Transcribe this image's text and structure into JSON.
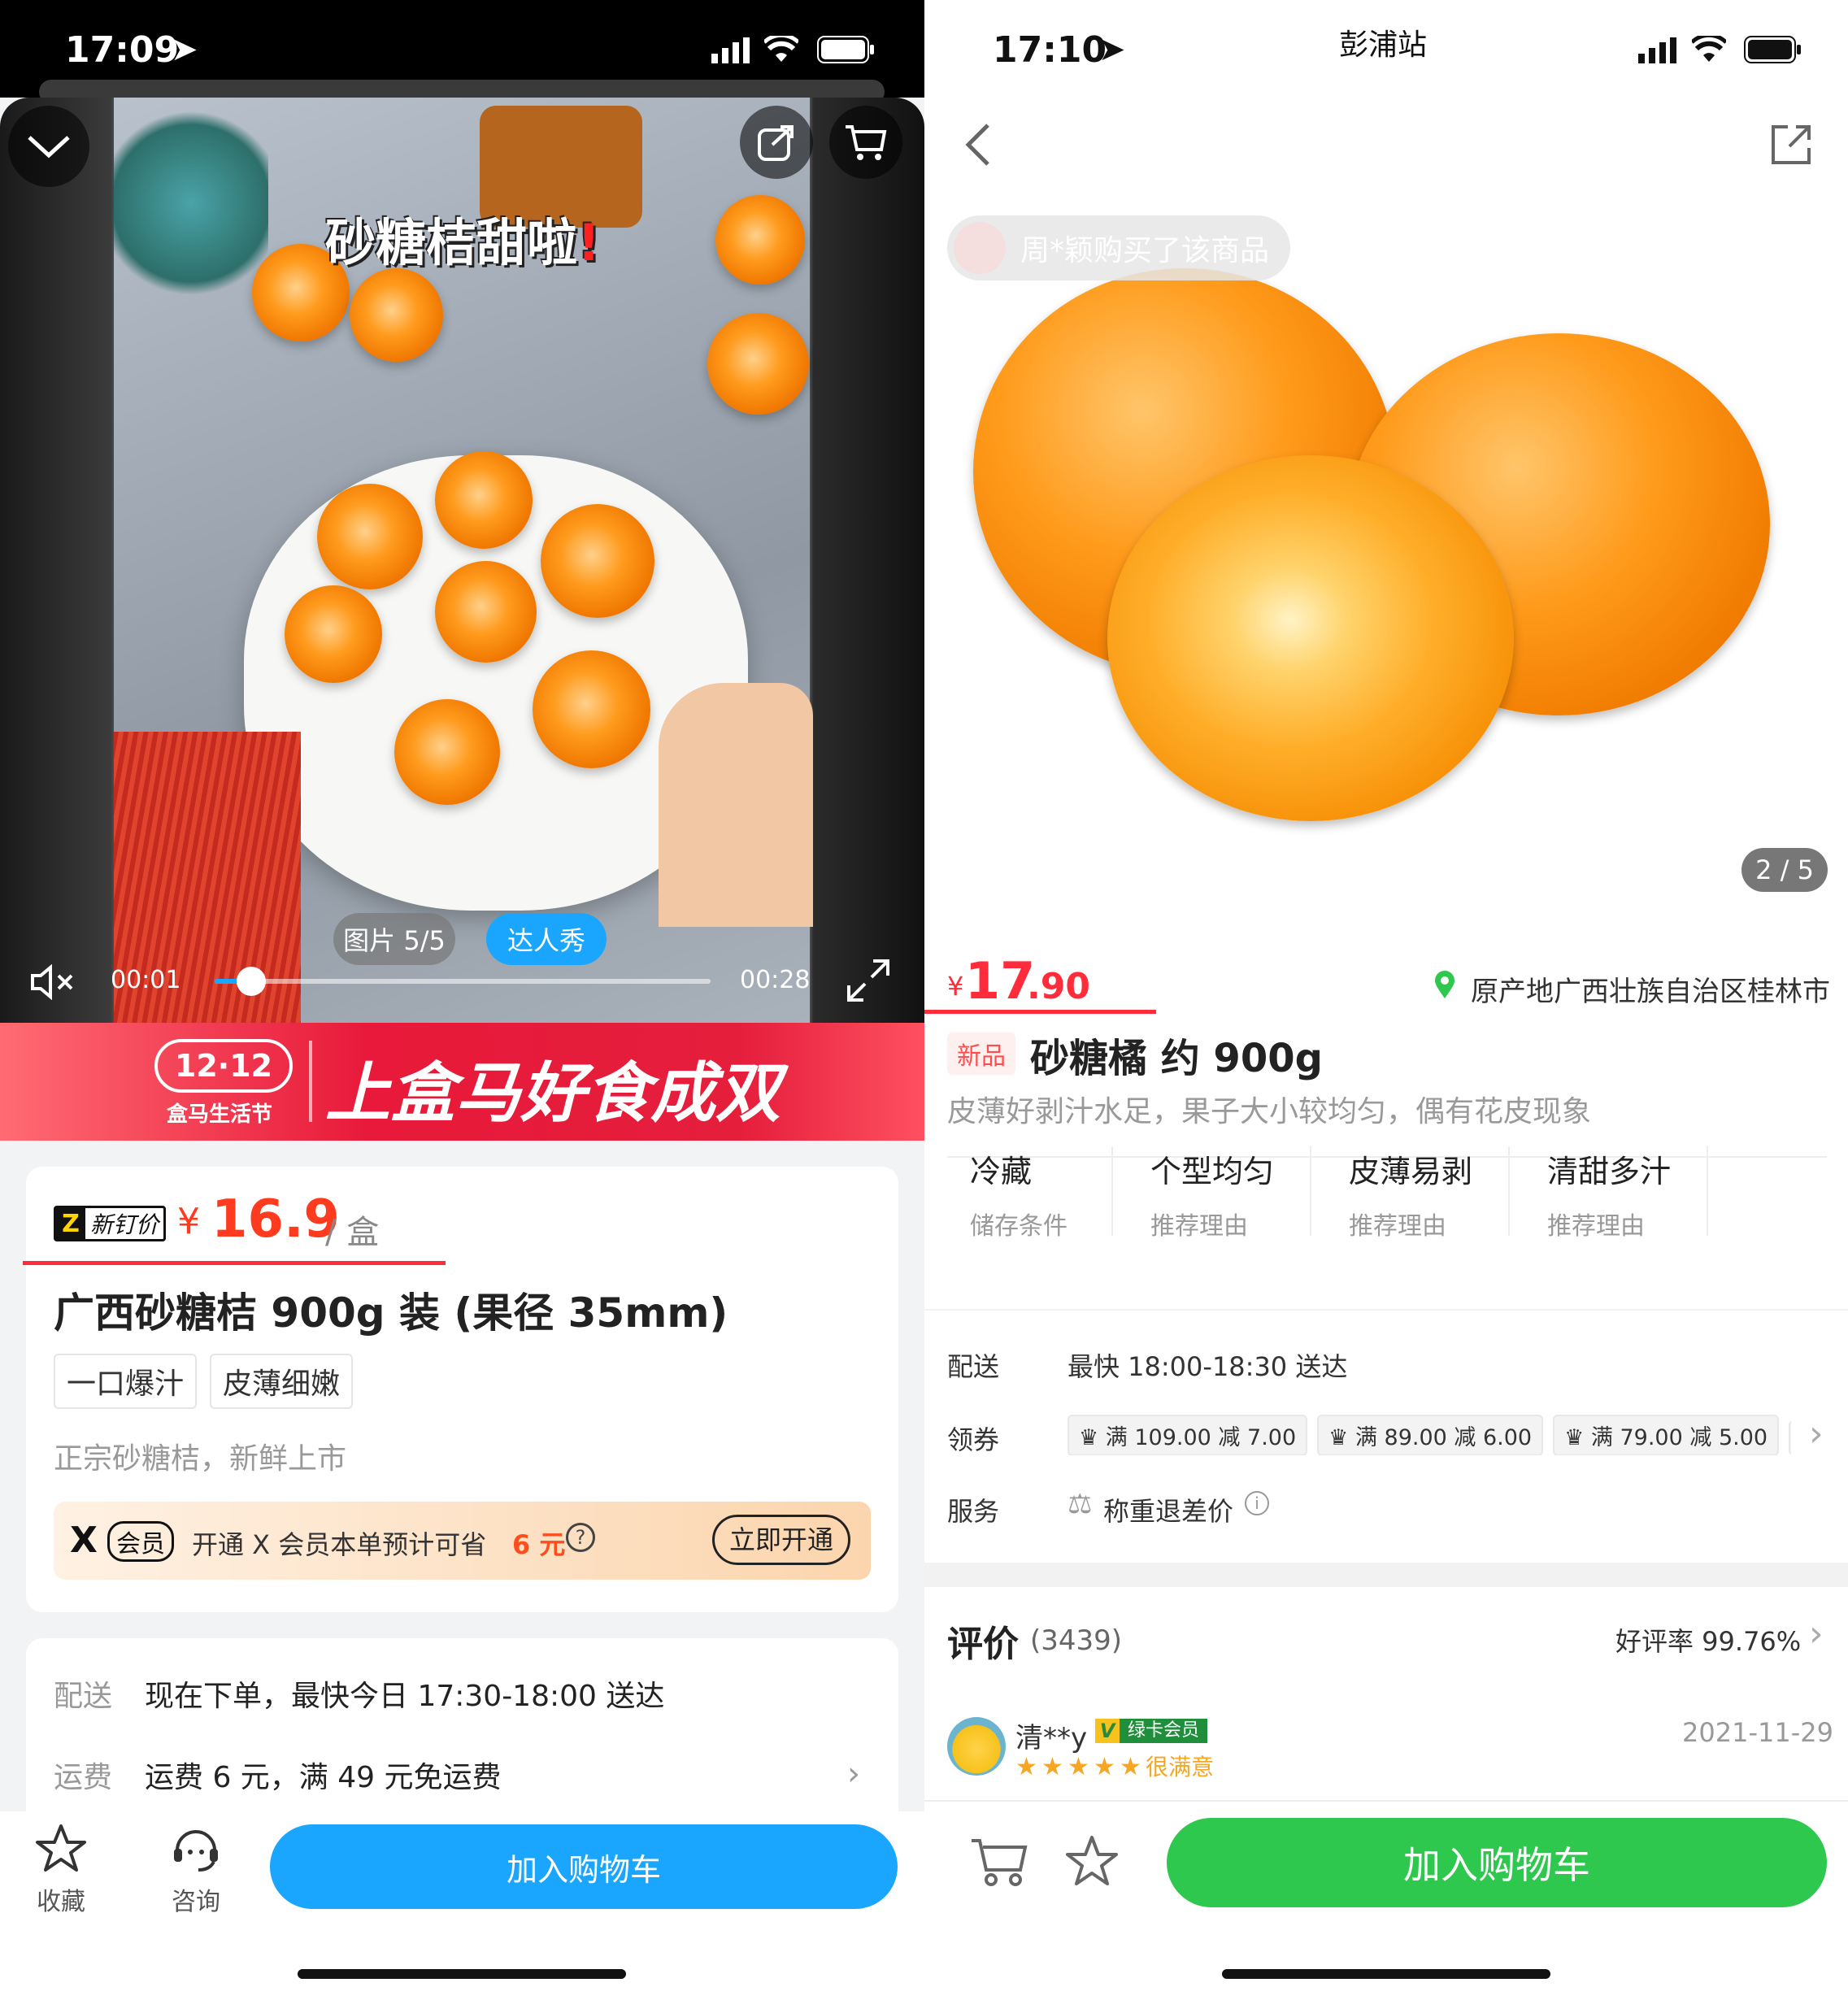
{
  "left": {
    "status_time": "17:09",
    "video": {
      "overlay_title": "砂糖桔甜啦",
      "image_counter": "图片 5/5",
      "influencer_tab": "达人秀",
      "time_current": "00:01",
      "time_total": "00:28",
      "progress": 0.05
    },
    "banner": {
      "badge": "12·12",
      "badge_sub": "盒马生活节",
      "slogan": "上盒马好食成双"
    },
    "price_card": {
      "price_tag": "新钉价",
      "currency": "¥",
      "price": "16.9",
      "unit": "/ 盒",
      "title": "广西砂糖桔 900g 装 (果径 35mm)",
      "tags": [
        "一口爆汁",
        "皮薄细嫩"
      ],
      "subtitle": "正宗砂糖桔，新鲜上市",
      "member_badge": "会员",
      "member_text": "开通 X 会员本单预计可省",
      "member_save": "6 元",
      "member_button": "立即开通"
    },
    "delivery_card": {
      "delivery_label": "配送",
      "delivery_value": "现在下单，最快今日 17:30-18:00 送达",
      "fee_label": "运费",
      "fee_value": "运费 6 元，满 49 元免运费"
    },
    "bottom": {
      "favorite": "收藏",
      "consult": "咨询",
      "add_cart": "加入购物车"
    }
  },
  "right": {
    "status_time": "17:10",
    "store_name": "彭浦站",
    "buyer_notice": "周*颖购买了该商品",
    "image_counter": "2 / 5",
    "currency": "¥",
    "price_int": "17",
    "price_dec": ".90",
    "origin": "原产地广西壮族自治区桂林市",
    "new_tag": "新品",
    "title": "砂糖橘 约 900g",
    "subtitle": "皮薄好剥汁水足，果子大小较均匀，偶有花皮现象",
    "features": [
      {
        "title": "冷藏",
        "sub": "储存条件"
      },
      {
        "title": "个型均匀",
        "sub": "推荐理由"
      },
      {
        "title": "皮薄易剥",
        "sub": "推荐理由"
      },
      {
        "title": "清甜多汁",
        "sub": "推荐理由"
      }
    ],
    "delivery_label": "配送",
    "delivery_value": "最快 18:00-18:30 送达",
    "coupon_label": "领券",
    "coupons": [
      "满 109.00 减 7.00",
      "满 89.00 减 6.00",
      "满 79.00 减 5.00"
    ],
    "service_label": "服务",
    "service_value": "称重退差价",
    "reviews": {
      "title": "评价",
      "count": "(3439)",
      "good_rate": "好评率 99.76%",
      "user": "清**y",
      "member_badge": "绿卡会员",
      "rating_text": "很满意",
      "date": "2021-11-29",
      "rating": 5
    },
    "add_cart": "加入购物车"
  },
  "colors": {
    "hema_blue": "#1aa5ff",
    "price_red": "#ff2d3b",
    "green_cta": "#2dc84d",
    "banner_red": "#e51e3c"
  }
}
